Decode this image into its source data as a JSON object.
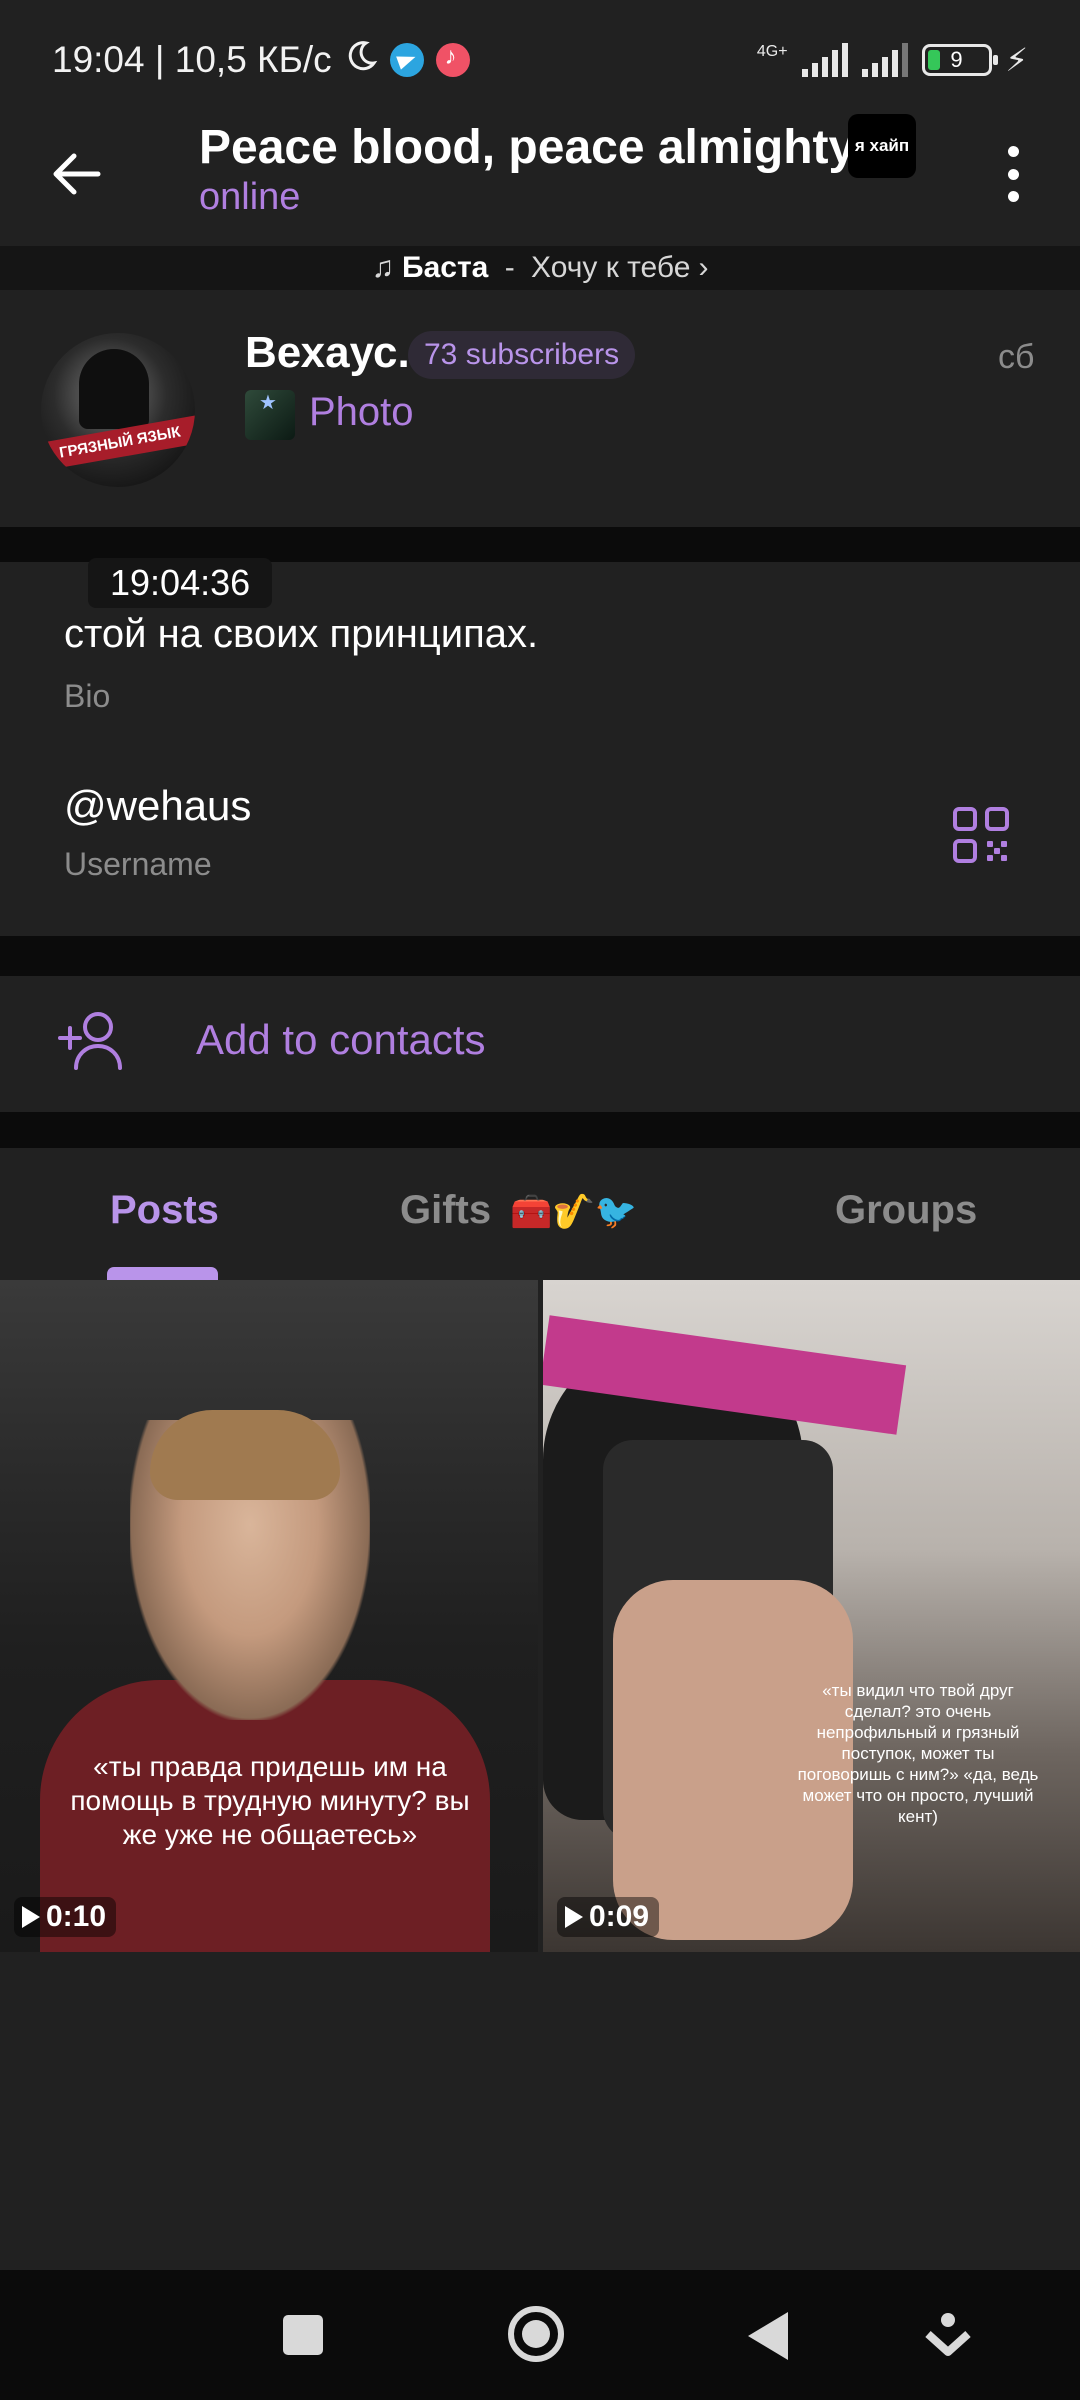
{
  "statusbar": {
    "time_speed": "19:04 | 10,5 КБ/с",
    "network": "4G+",
    "battery": "9",
    "icons": [
      "moon-icon",
      "telegram-icon",
      "music-app-icon",
      "signal-icon",
      "signal-icon",
      "battery-icon",
      "charging-bolt-icon"
    ]
  },
  "header": {
    "title": "Peace blood, peace almighty",
    "badge": "я хайп",
    "status": "online"
  },
  "now_playing": {
    "artist": "Баста",
    "separator": " - ",
    "track": "Хочу к тебе",
    "chevron": "›"
  },
  "channel": {
    "avatar_text": "ГРЯЗНЫЙ ЯЗЫК",
    "name": "Вехаус.",
    "subscribers": "73 subscribers",
    "last_message": "Photo",
    "day": "сб"
  },
  "info": {
    "time_pill": "19:04:36",
    "bio": "стой на своих принципах.",
    "bio_label": "Bio",
    "username": "@wehaus",
    "username_label": "Username"
  },
  "actions": {
    "add_contacts": "Add to contacts"
  },
  "tabs": [
    {
      "label": "Posts",
      "active": true
    },
    {
      "label": "Gifts",
      "emoji": "🧰🎷🐦",
      "active": false
    },
    {
      "label": "Groups",
      "active": false
    }
  ],
  "posts": [
    {
      "caption": "«ты правда придешь им на помощь в трудную минуту? вы же уже не общаетесь»",
      "duration": "0:10"
    },
    {
      "caption": "«ты видил что твой друг сделал? это очень непрофильный и грязный поступок, может ты поговоришь с ним?» «да, ведь может что он просто, лучший кент)",
      "duration": "0:09"
    }
  ],
  "colors": {
    "accent": "#b994ea",
    "link": "#b07fe0",
    "background": "#212121",
    "separator": "#0b0b0b"
  }
}
